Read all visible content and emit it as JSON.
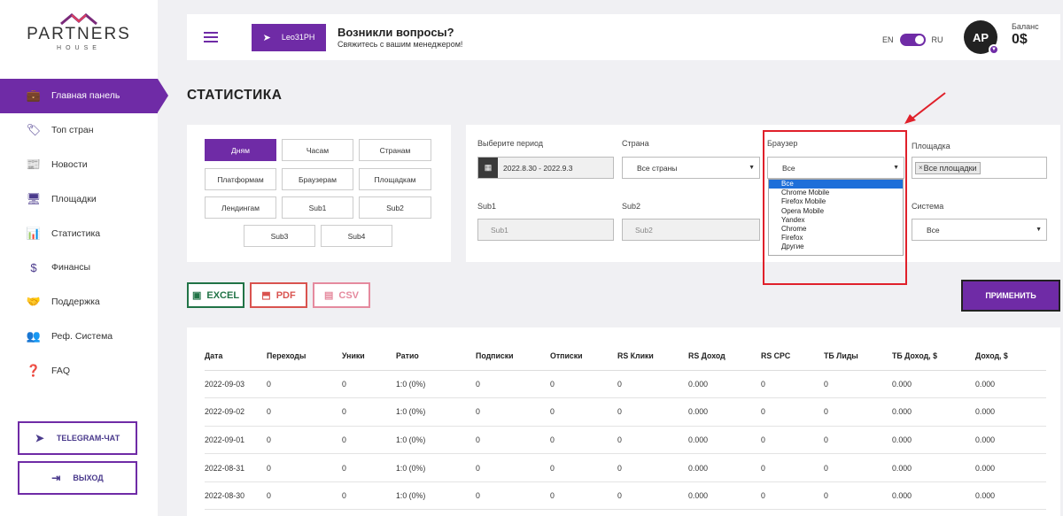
{
  "logo": {
    "name": "PARTNERS",
    "sub": "HOUSE"
  },
  "nav": [
    {
      "label": "Главная панель",
      "icon": "briefcase-icon",
      "glyph": "💼",
      "active": true
    },
    {
      "label": "Топ стран",
      "icon": "tag-icon",
      "glyph": "🏷",
      "active": false
    },
    {
      "label": "Новости",
      "icon": "newspaper-icon",
      "glyph": "📰",
      "active": false
    },
    {
      "label": "Площадки",
      "icon": "monitor-icon",
      "glyph": "🖥",
      "active": false
    },
    {
      "label": "Статистика",
      "icon": "bar-chart-icon",
      "glyph": "📊",
      "active": false
    },
    {
      "label": "Финансы",
      "icon": "dollar-icon",
      "glyph": "$",
      "active": false
    },
    {
      "label": "Поддержка",
      "icon": "handshake-icon",
      "glyph": "🤝",
      "active": false
    },
    {
      "label": "Реф. Система",
      "icon": "users-icon",
      "glyph": "👥",
      "active": false
    },
    {
      "label": "FAQ",
      "icon": "question-icon",
      "glyph": "❓",
      "active": false
    }
  ],
  "telegram_chat": "TELEGRAM-ЧАТ",
  "logout": "ВЫХОД",
  "header": {
    "manager_badge": "Leo31PH",
    "question_title": "Возникли вопросы?",
    "question_sub": "Свяжитесь с вашим менеджером!",
    "lang_en": "EN",
    "lang_ru": "RU",
    "avatar_initials": "AP",
    "balance_label": "Баланс",
    "balance_value": "0$"
  },
  "page_title": "СТАТИСТИКА",
  "group_by": [
    "Дням",
    "Часам",
    "Странам",
    "Платформам",
    "Браузерам",
    "Площадкам",
    "Лендингам",
    "Sub1",
    "Sub2",
    "Sub3",
    "Sub4"
  ],
  "filters": {
    "period_label": "Выберите период",
    "period_value": "2022.8.30 - 2022.9.3",
    "country_label": "Страна",
    "country_value": "Все страны",
    "browser_label": "Браузер",
    "browser_value": "Все",
    "platform_label": "Площадка",
    "platform_tag": "Все площадки",
    "sub1_label": "Sub1",
    "sub1_placeholder": "Sub1",
    "sub2_label": "Sub2",
    "sub2_placeholder": "Sub2",
    "system_label": "Система",
    "system_value": "Все"
  },
  "browser_options": [
    "Все",
    "Chrome Mobile",
    "Firefox Mobile",
    "Opera Mobile",
    "Yandex",
    "Chrome",
    "Firefox",
    "Другие"
  ],
  "export": {
    "excel": "EXCEL",
    "pdf": "PDF",
    "csv": "CSV"
  },
  "apply": "ПРИМЕНИТЬ",
  "table": {
    "columns": [
      "Дата",
      "Переходы",
      "Уники",
      "Ратио",
      "Подписки",
      "Отписки",
      "RS Клики",
      "RS Доход",
      "RS CPC",
      "ТБ Лиды",
      "ТБ Доход, $",
      "Доход, $"
    ],
    "rows": [
      [
        "2022-09-03",
        "0",
        "0",
        "1:0 (0%)",
        "0",
        "0",
        "0",
        "0.000",
        "0",
        "0",
        "0.000",
        "0.000"
      ],
      [
        "2022-09-02",
        "0",
        "0",
        "1:0 (0%)",
        "0",
        "0",
        "0",
        "0.000",
        "0",
        "0",
        "0.000",
        "0.000"
      ],
      [
        "2022-09-01",
        "0",
        "0",
        "1:0 (0%)",
        "0",
        "0",
        "0",
        "0.000",
        "0",
        "0",
        "0.000",
        "0.000"
      ],
      [
        "2022-08-31",
        "0",
        "0",
        "1:0 (0%)",
        "0",
        "0",
        "0",
        "0.000",
        "0",
        "0",
        "0.000",
        "0.000"
      ],
      [
        "2022-08-30",
        "0",
        "0",
        "1:0 (0%)",
        "0",
        "0",
        "0",
        "0.000",
        "0",
        "0",
        "0.000",
        "0.000"
      ]
    ]
  },
  "colors": {
    "accent": "#6f2ba6",
    "highlight": "#e0202a",
    "excel": "#217346",
    "pdf": "#d9534f",
    "csv": "#e58a9e"
  }
}
